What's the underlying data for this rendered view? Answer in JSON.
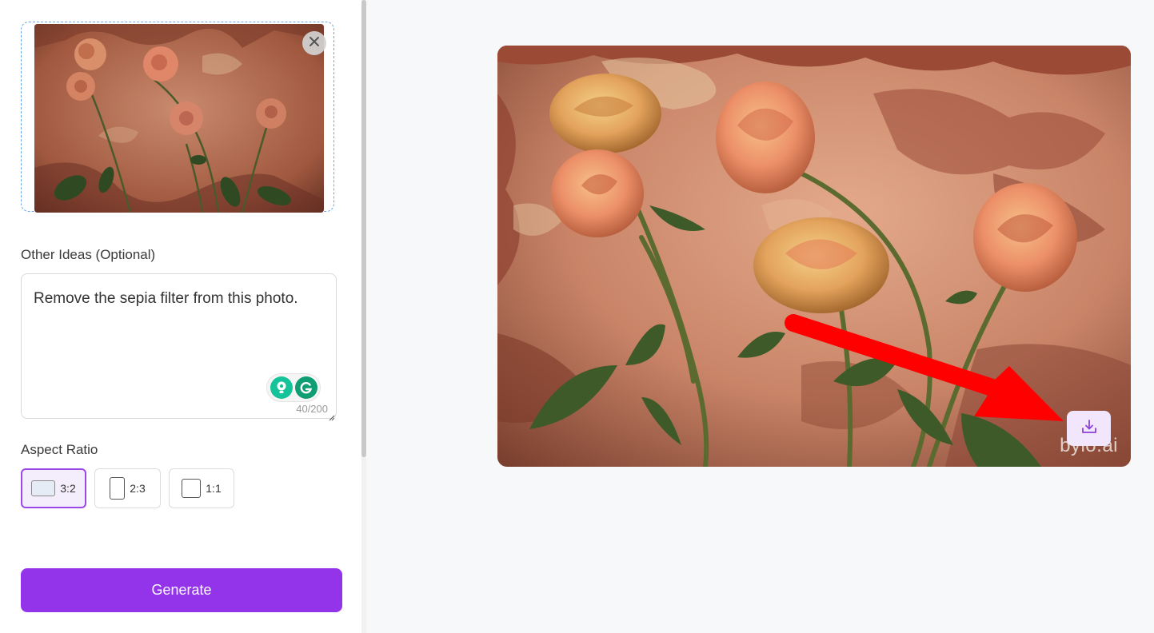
{
  "upload": {
    "remove_icon": "close-icon"
  },
  "ideas": {
    "label": "Other Ideas (Optional)",
    "value": "Remove the sepia filter from this photo.",
    "char_count": "40/200"
  },
  "aspect": {
    "label": "Aspect Ratio",
    "options": [
      {
        "label": "3:2",
        "selected": true
      },
      {
        "label": "2:3",
        "selected": false
      },
      {
        "label": "1:1",
        "selected": false
      }
    ]
  },
  "generate": {
    "label": "Generate",
    "color": "#9333ea"
  },
  "result": {
    "watermark": "bylo.ai",
    "download_icon": "download-icon"
  },
  "colors": {
    "accent": "#9333ea",
    "selected_border": "#9b48e8",
    "upload_border": "#6aa6e8",
    "annotation_arrow": "#ff0000"
  }
}
